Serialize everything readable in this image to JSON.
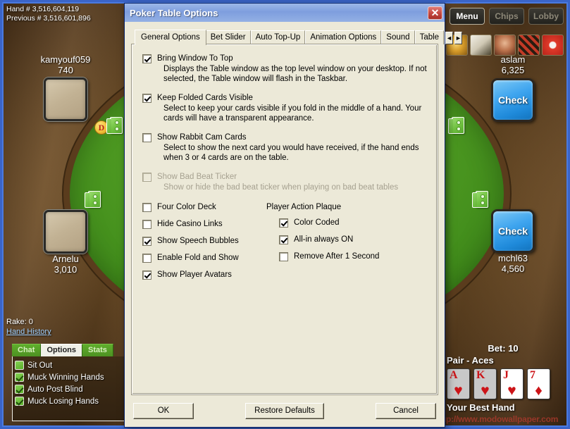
{
  "table": {
    "hand_number": "Hand # 3,516,604,119",
    "previous_hand_number": "Previous # 3,516,601,896",
    "rake": "Rake: 0",
    "hand_history_link": "Hand History",
    "dealer_button": "D",
    "watermark": "up://www.modowallpaper.com",
    "topbar_buttons": [
      {
        "label": "Menu",
        "active": true
      },
      {
        "label": "Chips",
        "active": false
      },
      {
        "label": "Lobby",
        "active": false
      }
    ],
    "game_icons": [
      "lion-icon",
      "cards-icon",
      "face-icon",
      "roulette-icon",
      "timer-icon"
    ],
    "players": [
      {
        "name": "kamyouf059",
        "stack": "740",
        "action": null
      },
      {
        "name": "Arnelu",
        "stack": "3,010",
        "action": null
      },
      {
        "name": "aslam",
        "stack": "6,325",
        "action": "Check"
      },
      {
        "name": "mchl63",
        "stack": "4,560",
        "action": "Check"
      }
    ],
    "bet": "Bet: 10",
    "hand_rank": "Pair - Aces",
    "best_hand_label": "Your Best Hand",
    "hand_cards": [
      {
        "rank": "A",
        "suit": "♥",
        "dim": true
      },
      {
        "rank": "K",
        "suit": "♥",
        "dim": true
      },
      {
        "rank": "J",
        "suit": "♥",
        "dim": false
      },
      {
        "rank": "7",
        "suit": "♦",
        "dim": false
      }
    ],
    "chat_panel": {
      "tabs": [
        {
          "label": "Chat",
          "active": false
        },
        {
          "label": "Options",
          "active": true
        },
        {
          "label": "Stats",
          "active": false
        }
      ],
      "options": [
        {
          "label": "Sit Out",
          "checked": false
        },
        {
          "label": "Muck Winning Hands",
          "checked": true
        },
        {
          "label": "Auto Post Blind",
          "checked": true
        },
        {
          "label": "Muck Losing Hands",
          "checked": true
        }
      ]
    }
  },
  "dialog": {
    "title": "Poker Table Options",
    "close_label": "✕",
    "tabs": [
      {
        "label": "General Options",
        "active": true
      },
      {
        "label": "Bet Slider",
        "active": false
      },
      {
        "label": "Auto Top-Up",
        "active": false
      },
      {
        "label": "Animation Options",
        "active": false
      },
      {
        "label": "Sound",
        "active": false
      },
      {
        "label": "Table",
        "active": false
      }
    ],
    "tab_prev_arrow": "◄",
    "tab_next_arrow": "►",
    "option_blocks": [
      {
        "label": "Bring Window To Top",
        "checked": true,
        "disabled": false,
        "description": "Displays the Table window as the top level window on your desktop. If not selected, the Table window will flash in the Taskbar."
      },
      {
        "label": "Keep Folded Cards Visible",
        "checked": true,
        "disabled": false,
        "description": "Select to keep your cards visible if you fold in the middle of a hand. Your cards will have a transparent appearance."
      },
      {
        "label": "Show Rabbit Cam Cards",
        "checked": false,
        "disabled": false,
        "description": "Select to show the next card you would have received, if the hand ends when 3 or 4 cards are on the table."
      },
      {
        "label": "Show Bad Beat Ticker",
        "checked": false,
        "disabled": true,
        "description": "Show or hide the bad beat ticker when playing on bad beat tables"
      }
    ],
    "left_column_options": [
      {
        "label": "Four Color Deck",
        "checked": false
      },
      {
        "label": "Hide Casino Links",
        "checked": false
      },
      {
        "label": "Show Speech Bubbles",
        "checked": true
      },
      {
        "label": "Enable Fold and Show",
        "checked": false
      },
      {
        "label": "Show Player Avatars",
        "checked": true
      }
    ],
    "right_column_title": "Player Action Plaque",
    "right_column_options": [
      {
        "label": "Color Coded",
        "checked": true
      },
      {
        "label": "All-in always ON",
        "checked": true
      },
      {
        "label": "Remove After 1 Second",
        "checked": false
      }
    ],
    "buttons": {
      "ok": "OK",
      "restore_defaults": "Restore Defaults",
      "cancel": "Cancel"
    }
  }
}
